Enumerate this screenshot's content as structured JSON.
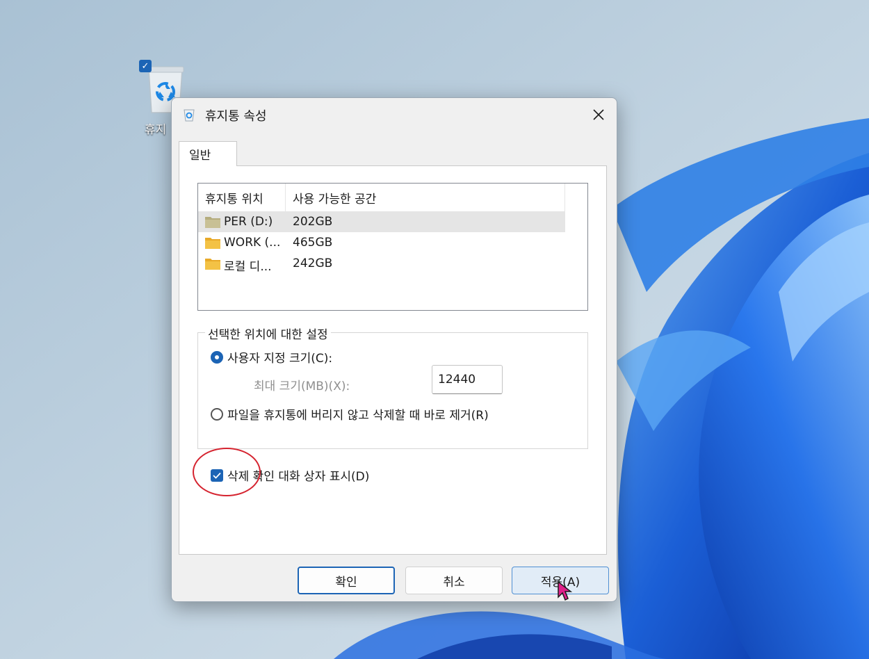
{
  "desktop": {
    "recycle_bin_label": "휴지"
  },
  "dialog": {
    "title": "휴지통 속성",
    "tab_general": "일반",
    "list": {
      "columns": [
        "휴지통 위치",
        "사용 가능한 공간"
      ],
      "rows": [
        {
          "name": "PER (D:)",
          "space": "202GB",
          "selected": true
        },
        {
          "name": "WORK (...",
          "space": "465GB",
          "selected": false
        },
        {
          "name": "로컬 디...",
          "space": "242GB",
          "selected": false
        }
      ]
    },
    "settings": {
      "group_label": "선택한 위치에 대한 설정",
      "custom_size_label": "사용자 지정 크기(C):",
      "max_size_label": "최대 크기(MB)(X):",
      "max_size_value": "12440",
      "no_recycle_label": "파일을 휴지통에 버리지 않고 삭제할 때 바로 제거(R)"
    },
    "confirm_checkbox_label": "삭제 확인 대화 상자 표시(D)",
    "buttons": {
      "ok": "확인",
      "cancel": "취소",
      "apply": "적용(A)"
    }
  },
  "colors": {
    "accent": "#1c64b5",
    "highlight": "#d5232f",
    "folder": "#f3c245",
    "folder_drive": "#b5ad7e"
  }
}
